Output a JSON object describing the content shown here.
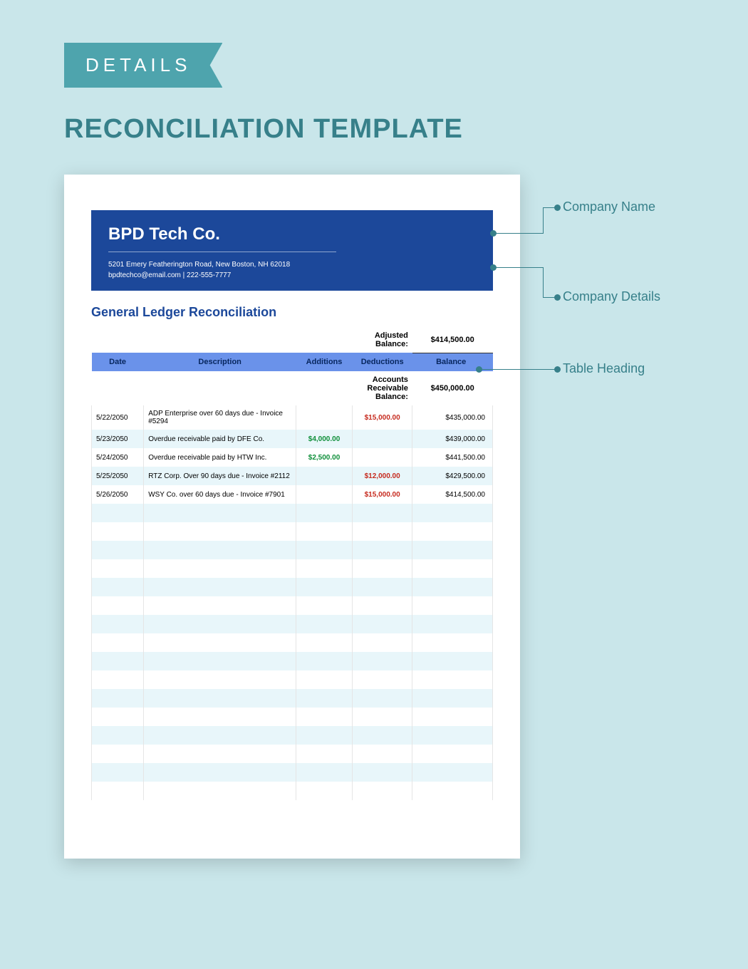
{
  "ribbon": "DETAILS",
  "title": "RECONCILIATION TEMPLATE",
  "company": {
    "name": "BPD Tech Co.",
    "address": "5201 Emery Featherington Road, New Boston, NH 62018",
    "contact": "bpdtechco@email.com | 222-555-7777"
  },
  "section": "General Ledger Reconciliation",
  "adjusted_label": "Adjusted Balance:",
  "adjusted_value": "$414,500.00",
  "columns": {
    "date": "Date",
    "desc": "Description",
    "add": "Additions",
    "ded": "Deductions",
    "bal": "Balance"
  },
  "ar_label": "Accounts Receivable Balance:",
  "ar_value": "$450,000.00",
  "rows": [
    {
      "date": "5/22/2050",
      "desc": "ADP Enterprise over 60 days due - Invoice #5294",
      "add": "",
      "ded": "$15,000.00",
      "bal": "$435,000.00"
    },
    {
      "date": "5/23/2050",
      "desc": "Overdue receivable paid by DFE Co.",
      "add": "$4,000.00",
      "ded": "",
      "bal": "$439,000.00"
    },
    {
      "date": "5/24/2050",
      "desc": "Overdue receivable paid by HTW Inc.",
      "add": "$2,500.00",
      "ded": "",
      "bal": "$441,500.00"
    },
    {
      "date": "5/25/2050",
      "desc": "RTZ Corp. Over 90 days due - Invoice #2112",
      "add": "",
      "ded": "$12,000.00",
      "bal": "$429,500.00"
    },
    {
      "date": "5/26/2050",
      "desc": "WSY Co. over 60 days due - Invoice #7901",
      "add": "",
      "ded": "$15,000.00",
      "bal": "$414,500.00"
    }
  ],
  "annotations": {
    "company_name": "Company Name",
    "company_details": "Company Details",
    "table_heading": "Table Heading"
  }
}
